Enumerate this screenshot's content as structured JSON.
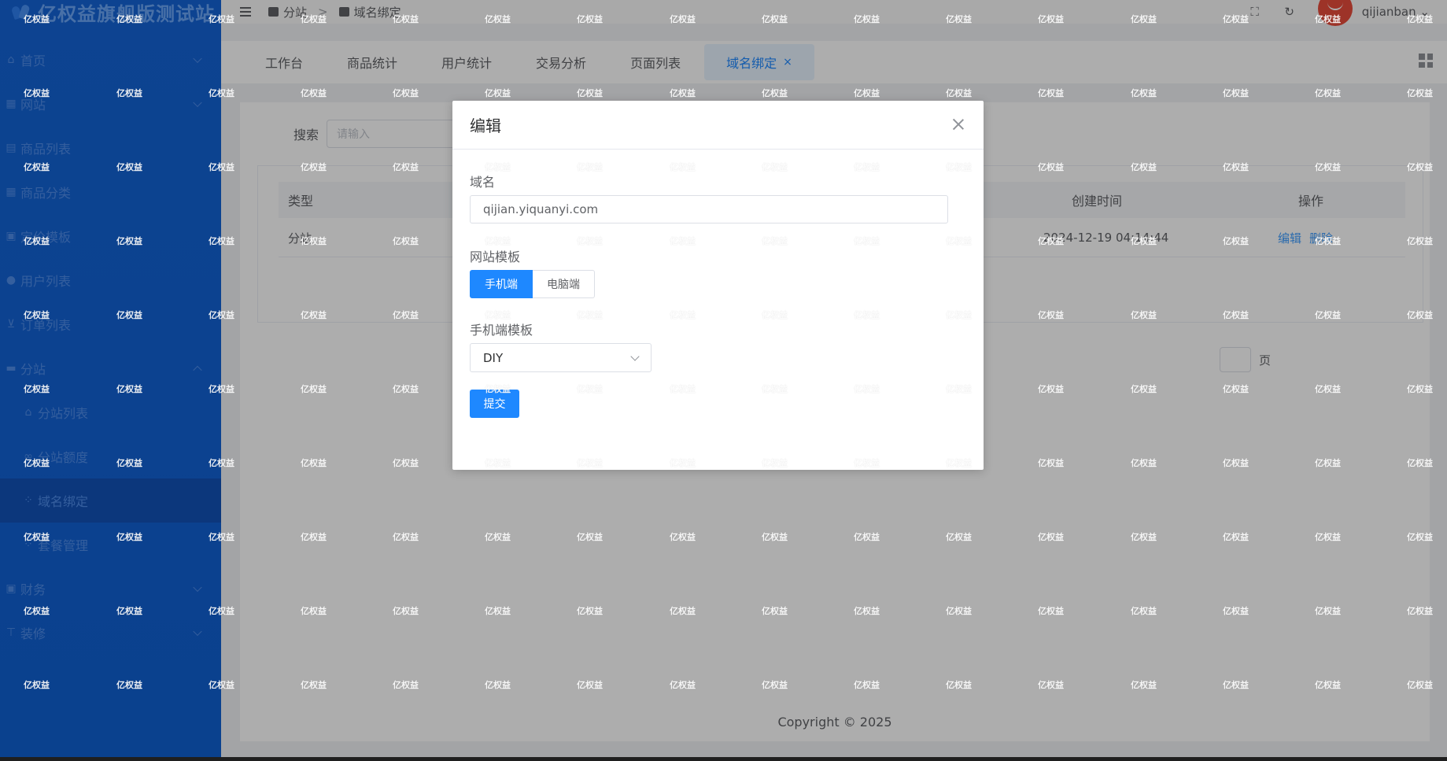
{
  "app": {
    "brand_title": "亿权益旗舰版测试站"
  },
  "sidebar": {
    "items": [
      {
        "label": "首页",
        "icon": "home-icon",
        "expandable": true
      },
      {
        "label": "网站",
        "icon": "building-icon",
        "expandable": true
      },
      {
        "label": "商品列表",
        "icon": "list-icon",
        "expandable": false
      },
      {
        "label": "商品分类",
        "icon": "grid-icon",
        "expandable": false
      },
      {
        "label": "定价模板",
        "icon": "tag-icon",
        "expandable": false
      },
      {
        "label": "用户列表",
        "icon": "user-icon",
        "expandable": false
      },
      {
        "label": "订单列表",
        "icon": "cart-icon",
        "expandable": false
      },
      {
        "label": "分站",
        "icon": "station-icon",
        "expandable": true,
        "expanded": true
      },
      {
        "label": "分站列表",
        "icon": "shop-icon",
        "sub": true
      },
      {
        "label": "分站额度",
        "icon": "quota-icon",
        "sub": true
      },
      {
        "label": "域名绑定",
        "icon": "apps-icon",
        "sub": true,
        "active": true
      },
      {
        "label": "套餐管理",
        "icon": "package-icon",
        "sub": true
      },
      {
        "label": "财务",
        "icon": "finance-icon",
        "expandable": true
      },
      {
        "label": "装修",
        "icon": "decorate-icon",
        "expandable": true
      }
    ]
  },
  "header": {
    "breadcrumb": [
      "分站",
      ">",
      "域名绑定"
    ],
    "username": "qijianban"
  },
  "tabs": [
    {
      "label": "工作台"
    },
    {
      "label": "商品统计"
    },
    {
      "label": "用户统计"
    },
    {
      "label": "交易分析"
    },
    {
      "label": "页面列表"
    },
    {
      "label": "域名绑定",
      "active": true,
      "close": "×"
    }
  ],
  "main": {
    "search_label": "搜索",
    "search_placeholder": "请输入",
    "columns": [
      "类型",
      "创建时间",
      "操作"
    ],
    "row": {
      "type": "分站",
      "created_at": "2024-12-19 04:14:44",
      "actions": [
        "编辑",
        "删除"
      ]
    },
    "pager_unit": "页",
    "copyright": "Copyright © 2025"
  },
  "dialog": {
    "title": "编辑",
    "domain_label": "域名",
    "domain_value": "qijian.yiquanyi.com",
    "template_label": "网站模板",
    "template_options": [
      "手机端",
      "电脑端"
    ],
    "template_selected": "手机端",
    "mobile_template_label": "手机端模板",
    "mobile_template_value": "DIY",
    "submit_label": "提交"
  },
  "watermark": {
    "text": "亿权益"
  },
  "colors": {
    "primary": "#1e88ff",
    "sidebar": "#1463d4",
    "overlay": "rgba(0,0,0,0.32)"
  }
}
